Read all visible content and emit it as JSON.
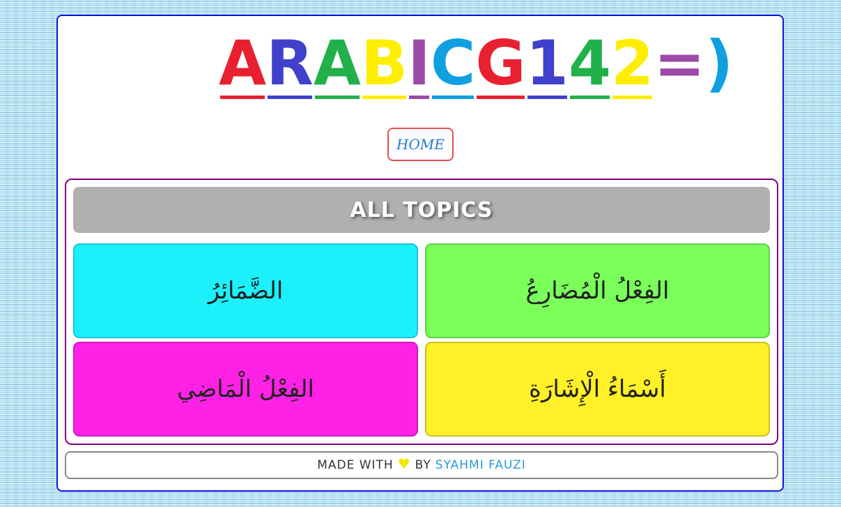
{
  "logo": {
    "letters": [
      {
        "char": "A",
        "color": "#e82030"
      },
      {
        "char": "R",
        "color": "#4040cc"
      },
      {
        "char": "A",
        "color": "#22b04a"
      },
      {
        "char": "B",
        "color": "#ffee00"
      },
      {
        "char": "I",
        "color": "#9b4aa8"
      },
      {
        "char": "C",
        "color": "#10a0e0"
      },
      {
        "char": "G",
        "color": "#e82030"
      },
      {
        "char": "1",
        "color": "#4040cc"
      },
      {
        "char": "4",
        "color": "#22b04a"
      },
      {
        "char": "2",
        "color": "#ffee00"
      },
      {
        "char": "=",
        "color": "#9b4aa8"
      },
      {
        "char": ")",
        "color": "#10a0e0"
      }
    ],
    "text": "ARABIC G142=)"
  },
  "nav": {
    "home_label": "HOME"
  },
  "topics": {
    "header": "ALL TOPICS",
    "cards": [
      {
        "label": "الضَّمَائِرُ",
        "color": "#1cf0fb"
      },
      {
        "label": "الفِعْلُ الْمُضَارِعُ",
        "color": "#7aff5b"
      },
      {
        "label": "الفِعْلُ الْمَاضِي",
        "color": "#ff22e6"
      },
      {
        "label": "أَسْمَاءُ الْإِشَارَةِ",
        "color": "#fff027"
      }
    ]
  },
  "footer": {
    "made_with": "MADE WITH",
    "heart_icon": "heart-icon",
    "by": "BY",
    "author": "SYAHMI FAUZI"
  }
}
